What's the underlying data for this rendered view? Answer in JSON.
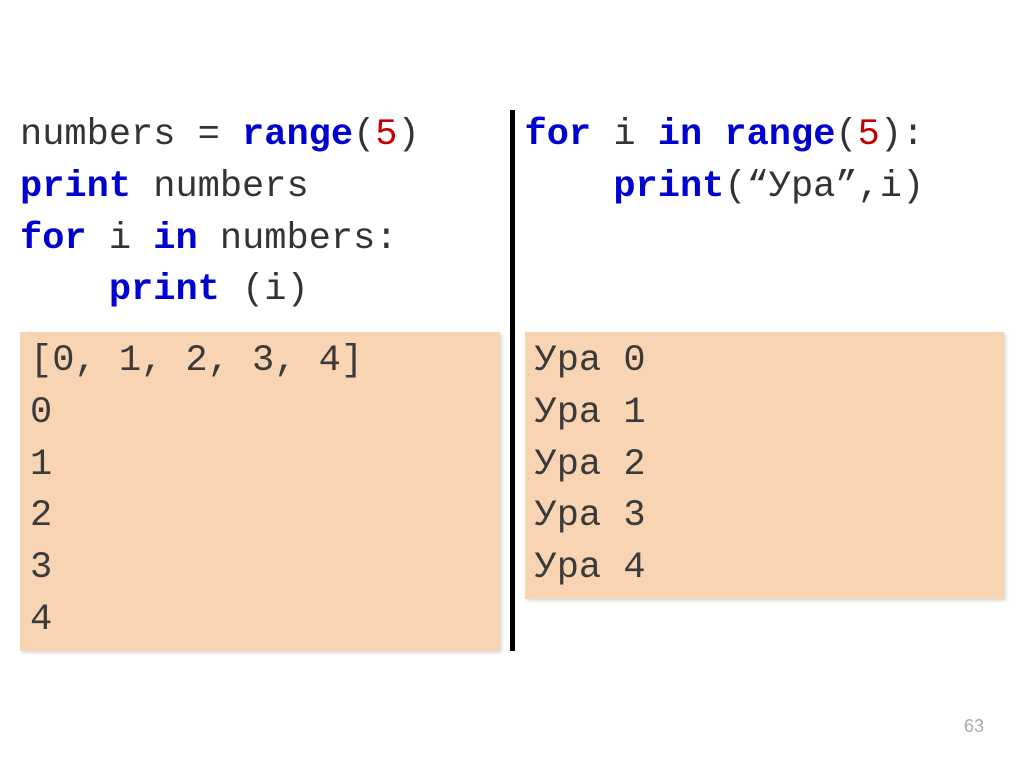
{
  "left": {
    "code": {
      "line1_pre": "numbers = ",
      "line1_kw": "range",
      "line1_paren_open": "(",
      "line1_num": "5",
      "line1_paren_close": ")",
      "line2_kw": "print",
      "line2_rest": " numbers",
      "line3_kw1": "for",
      "line3_mid": " i ",
      "line3_kw2": "in",
      "line3_rest": " numbers:",
      "line4_indent": "    ",
      "line4_kw": "print",
      "line4_rest": " (i)"
    },
    "output": "[0, 1, 2, 3, 4]\n0\n1\n2\n3\n4"
  },
  "right": {
    "code": {
      "line1_kw1": "for",
      "line1_mid": " i ",
      "line1_kw2": "in",
      "line1_range": " range",
      "line1_paren_open": "(",
      "line1_num": "5",
      "line1_paren_close": "):",
      "line2_indent": "    ",
      "line2_kw": "print",
      "line2_rest": "(“Ура”,i)"
    },
    "output": "Ура 0\nУра 1\nУра 2\nУра 3\nУра 4"
  },
  "page_number": "63"
}
